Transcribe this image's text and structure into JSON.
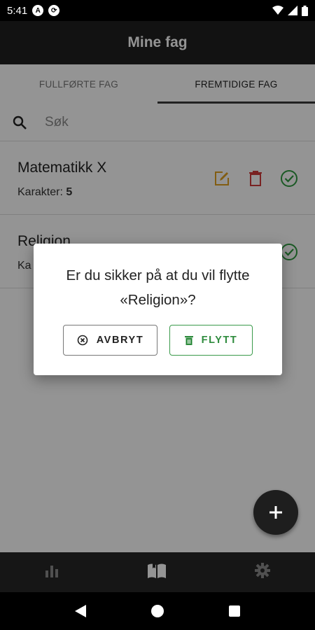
{
  "status_bar": {
    "time": "5:41"
  },
  "app_bar": {
    "title": "Mine fag"
  },
  "tabs": [
    {
      "label": "FULLFØRTE FAG",
      "active": false
    },
    {
      "label": "FREMTIDIGE FAG",
      "active": true
    }
  ],
  "search": {
    "placeholder": "Søk"
  },
  "subjects": [
    {
      "name": "Matematikk X",
      "grade_label": "Karakter:",
      "grade": "5"
    },
    {
      "name": "Religion",
      "grade_label": "Ka"
    }
  ],
  "dialog": {
    "message_line1": "Er du sikker på at du vil flytte",
    "message_line2": "«Religion»?",
    "cancel_label": "AVBRYT",
    "move_label": "FLYTT"
  },
  "colors": {
    "edit": "#e0a020",
    "delete": "#d03b3b",
    "complete": "#2e9a3f",
    "move_button": "#2e8b3d"
  },
  "icons": [
    "search-icon",
    "edit-icon",
    "delete-icon",
    "check-circle-icon",
    "cancel-icon",
    "trash-icon",
    "add-icon",
    "bar-chart-icon",
    "book-icon",
    "settings-icon",
    "back-icon",
    "home-icon",
    "recents-icon"
  ]
}
